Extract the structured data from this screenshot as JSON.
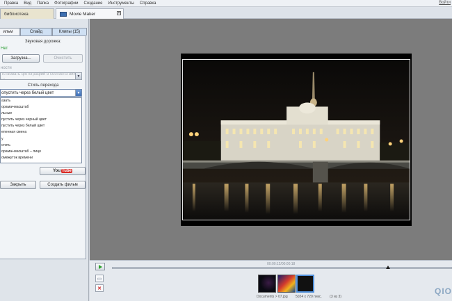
{
  "menu": {
    "items": [
      "Правка",
      "Вид",
      "Папка",
      "Фотографии",
      "Создание",
      "Инструменты",
      "Справка"
    ],
    "login": "Войти"
  },
  "app_tabs": {
    "library": "библиотека",
    "movie_maker": "Movie Maker",
    "close_glyph": "✕"
  },
  "left_panel": {
    "subtabs": [
      "ильм",
      "Слайд",
      "Клипы (15)"
    ],
    "audio_label": "Звуковая дорожка:",
    "audio_value": "Нет",
    "load_button": "Загрузка...",
    "clear_button": "Очистить",
    "durations_label": "ности",
    "fit_select": "тствовать фотографий в соответствии с ...",
    "transition_label": "Стиль перехода",
    "transition_value": "опустить через белый цвет",
    "transition_options": [
      "азать",
      "орама+масштаб",
      "льные",
      "пустить через черный цвет",
      "пустить через белый цвет",
      "епенная смена",
      "у",
      "стить",
      "орама+масштаб – лицо",
      "омежуток времени"
    ],
    "youtube": {
      "you": "You",
      "tube": "Tube"
    },
    "close_button": "Закрыть",
    "create_button": "Создать фильм"
  },
  "player": {
    "timecode": "00:00:12/00:00:18",
    "status_file": "Documents > 07.jpg",
    "status_size": "5024 x 720 пикс.",
    "status_count": "(3 из 3)"
  },
  "brand": "QIO"
}
